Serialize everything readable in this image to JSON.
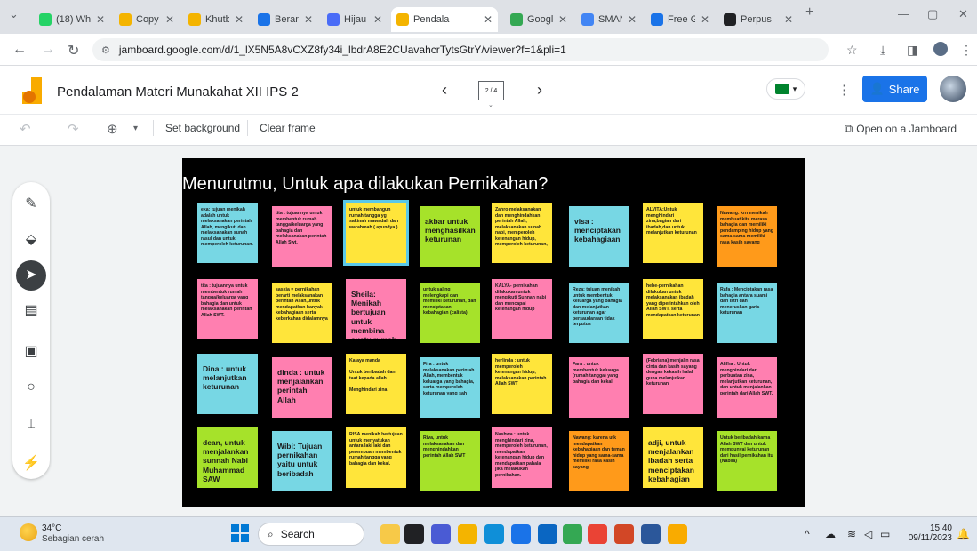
{
  "browser": {
    "tabs": [
      {
        "label": "(18) Wh",
        "fav_color": "#25d366",
        "x": 0
      },
      {
        "label": "Copy o",
        "fav_color": "#f4b400",
        "x": 1
      },
      {
        "label": "Khutba",
        "fav_color": "#f4b400",
        "x": 2
      },
      {
        "label": "Berand",
        "fav_color": "#1a73e8",
        "x": 3
      },
      {
        "label": "Hijau K",
        "fav_color": "#4a6cf7",
        "x": 4
      },
      {
        "label": "Pendala",
        "fav_color": "#f4b400",
        "x": 5
      },
      {
        "label": "Google",
        "fav_color": "#34a853",
        "x": 6
      },
      {
        "label": "SMAN",
        "fav_color": "#4285f4",
        "x": 7
      },
      {
        "label": "Free Gr",
        "fav_color": "#1a73e8",
        "x": 8
      },
      {
        "label": "Perpus",
        "fav_color": "#202124",
        "x": 9
      }
    ],
    "new_tab": "+",
    "url": "jamboard.google.com/d/1_lX5N5A8vCXZ8fy34i_lbdrA8E2CUavahcrTytsGtrY/viewer?f=1&pli=1"
  },
  "app": {
    "title": "Pendalaman Materi Munakahat XII IPS 2",
    "frame_counter": "2 / 4",
    "share_label": "Share",
    "toolbar": {
      "set_background": "Set background",
      "clear_frame": "Clear frame",
      "open_on_jamboard": "Open on a Jamboard"
    }
  },
  "frame": {
    "title": "Menurutmu, Untuk apa dilakukan Pernikahan?",
    "notes": [
      {
        "text": "eka: tujuan menikah adalah untuk melaksanakan perintah Allah, mengikuti dan melaksanakan sunah rasul dan untuk memperoleh keturunan.",
        "color": "#77d7e4",
        "size": "sm"
      },
      {
        "text": "tita : tujuannya untuk membentuk rumah tangga/keluarga yang bahagia dan melaksanakan perintah Allah Swt.",
        "color": "#ff7fb0",
        "size": "sm"
      },
      {
        "text": "untuk membangun rumah tangga yg sakinah mawadah dan warahmah ( ayundya )",
        "color": "#ffe53a",
        "size": "sm"
      },
      {
        "text": "akbar untuk menghasilkan keturunan",
        "color": "#a6e22a",
        "size": "lg"
      },
      {
        "text": "Zahro melaksanakan dan menghindahkan perintah Allah, melaksanakan sunah nabi, memperoleh ketenangan hidup, memperoleh keturunan,",
        "color": "#ffe53a",
        "size": "sm"
      },
      {
        "text": "visa : menciptakan kebahagiaan",
        "color": "#77d7e4",
        "size": "lg"
      },
      {
        "text": "ALVITA:Untuk menghindari zina,bagian dari ibadah,dan untuk melanjutkan keturunan",
        "color": "#ffe53a",
        "size": "sm"
      },
      {
        "text": "Nawang: krn menikah membuat kita merasa bahagia dan memiliki pendamping hidup yang sama-sama memiliki rasa kasih sayang",
        "color": "#ff9a1a",
        "size": "sm"
      },
      {
        "text": "tita : tujuannya untuk membentuk rumah tangga/keluarga yang bahagia dan untuk melaksanakan perintah Allah SWT.",
        "color": "#ff7fb0",
        "size": "sm"
      },
      {
        "text": "saskia = pernikahan berarti melaksanakan perintah Allah,untuk mendapatkan banyak kebahagiaan serta keberkahan didalamnya",
        "color": "#ffe53a",
        "size": "sm"
      },
      {
        "text": "Sheila: Menikah bertujuan untuk membina suatu rumah tangga yang sakinah mawadah dan warohmah",
        "color": "#ff7fb0",
        "size": "lg"
      },
      {
        "text": "untuk saling melengkapi dan memiliki keturunan, dan menciptakan kebahagian (calista)",
        "color": "#a6e22a",
        "size": "sm"
      },
      {
        "text": "KALYA- pernikahan dilakukan untuk mengikuti Sunnah nabi dan mencapai ketenangan hidup",
        "color": "#ff7fb0",
        "size": "sm"
      },
      {
        "text": "Reza: tujuan menikah untuk membentuk keluarga yang bahagia dan melanjutkan keturunan agar persaudaraan tidak terputus",
        "color": "#77d7e4",
        "size": "sm"
      },
      {
        "text": "hebe-pernikahan dilakukan untuk melaksanakan ibadah yang diperintahkan oleh Allah SWT. serta mendapatkan keturunan",
        "color": "#ffe53a",
        "size": "sm"
      },
      {
        "text": "Rafa : Menciptakan rasa bahagia antara suami dan istri dan meneruskan garis keturunan",
        "color": "#77d7e4",
        "size": "sm"
      },
      {
        "text": "Dina : untuk melanjutkan keturunan",
        "color": "#77d7e4",
        "size": "lg"
      },
      {
        "text": "dinda : untuk menjalankan perintah Allah",
        "color": "#ff7fb0",
        "size": "lg"
      },
      {
        "text": "Kalaya manda\n\nUntuk beribadah dan taat kepada allah\n\nMenghindari zina",
        "color": "#ffe53a",
        "size": "sm"
      },
      {
        "text": "Fira : untuk melaksanakan perintah Allah, membentuk keluarga yang bahagia, serta memperoleh keturunan yang sah",
        "color": "#77d7e4",
        "size": "sm"
      },
      {
        "text": "herlinda : untuk memperoleh ketenangan hidup, melaksanakan perintah Allah SWT",
        "color": "#ffe53a",
        "size": "sm"
      },
      {
        "text": "Fara : untuk membentuk keluarga (rumah tangga) yang bahagia dan kekal",
        "color": "#ff7fb0",
        "size": "sm"
      },
      {
        "text": "(Febriana) menjalin rasa cinta dan kasih sayang dengan kekasih halal guna melanjutkan keturunan",
        "color": "#ff7fb0",
        "size": "sm"
      },
      {
        "text": "Alifha : Untuk menghindari dari perbuatan zina, melanjutkan keturunan, dan untuk menjalankan perintah dari Allah SWT.",
        "color": "#ff7fb0",
        "size": "sm"
      },
      {
        "text": "dean, untuk menjalankan sunnah Nabi Muhammad SAW",
        "color": "#a6e22a",
        "size": "lg"
      },
      {
        "text": "Wibi: Tujuan pernikahan yaitu untuk beribadah",
        "color": "#77d7e4",
        "size": "lg"
      },
      {
        "text": "RISA menikah bertujuan untuk menyatukan antara laki laki dan perempuan membentuk rumah tangga yang bahagia dan kekal.",
        "color": "#ffe53a",
        "size": "sm"
      },
      {
        "text": "Riva, untuk melaksanakan dan menghindahkan perintah Allah SWT",
        "color": "#a6e22a",
        "size": "sm"
      },
      {
        "text": "Nashwa : untuk menghindari zina, memperoleh keturunan, mendapatkan ketenangan hidup dan mendapatkan pahala jika melakukan pernikahan.",
        "color": "#ff7fb0",
        "size": "sm"
      },
      {
        "text": "Nawang: karena utk mendapatkan kebahagiaan dan teman hidup yang sama-sama memiliki rasa kasih sayang",
        "color": "#ff9a1a",
        "size": "sm"
      },
      {
        "text": "adji, untuk menjalankan ibadah serta menciptakan kebahagian",
        "color": "#ffe53a",
        "size": "lg"
      },
      {
        "text": "Untuk beribadah karna Allah SWT dan untuk mempunyai keturunan dari hasil pernikahan itu (Nabila)",
        "color": "#a6e22a",
        "size": "sm"
      }
    ]
  },
  "taskbar": {
    "temp": "34°C",
    "weather": "Sebagian cerah",
    "search": "Search",
    "time": "15:40",
    "date": "09/11/2023"
  }
}
